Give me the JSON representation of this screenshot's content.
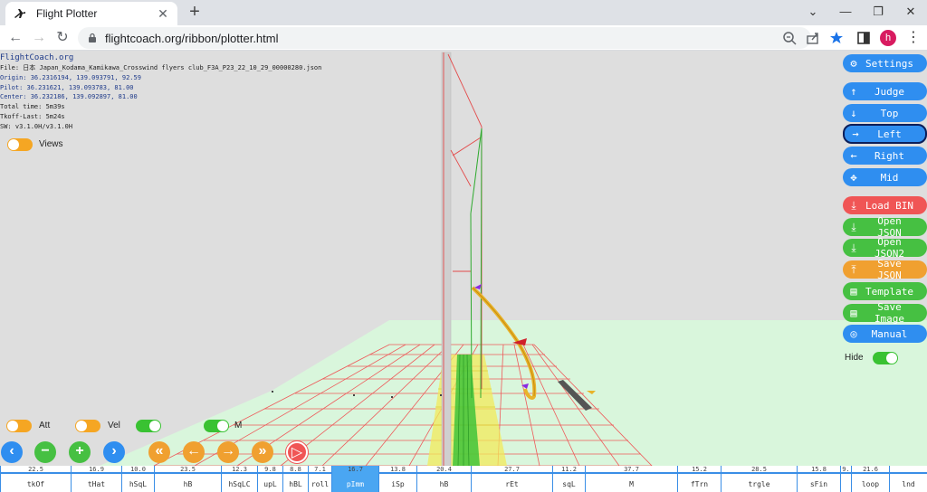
{
  "browser": {
    "tab_title": "Flight Plotter",
    "new_tab": "+",
    "url": "flightcoach.org/ribbon/plotter.html",
    "avatar_letter": "h",
    "minimize": "—",
    "maximize": "❐",
    "close": "✕"
  },
  "info": {
    "site": "FlightCoach.org",
    "file": "File: 日本 Japan_Kodama_Kamikawa_Crosswind flyers club_F3A_P23_22_10_29_00000280.json",
    "origin": "Origin: 36.2316194, 139.093791, 92.59",
    "pilot": "Pilot: 36.231621, 139.093783, 81.00",
    "center": "Center: 36.232186, 139.092897, 81.00",
    "total_time": "Total time: 5m39s",
    "tkoff_last": "Tkoff-Last: 5m24s",
    "sw": "SW: v3.1.0H/v3.1.0H"
  },
  "toggles": {
    "views": "Views",
    "att": "Att",
    "vel": "Vel",
    "m": "M",
    "hide": "Hide"
  },
  "right_buttons": [
    {
      "label": "Settings",
      "icon": "gear-icon",
      "glyph": "⚙"
    },
    {
      "label": "Judge",
      "icon": "arrow-up-icon",
      "glyph": "↑"
    },
    {
      "label": "Top",
      "icon": "arrow-down-icon",
      "glyph": "↓"
    },
    {
      "label": "Left",
      "icon": "arrow-right-icon",
      "glyph": "→"
    },
    {
      "label": "Right",
      "icon": "arrow-left-icon",
      "glyph": "←"
    },
    {
      "label": "Mid",
      "icon": "move-icon",
      "glyph": "✥"
    },
    {
      "label": "Load BIN",
      "icon": "download-icon",
      "glyph": "⤓"
    },
    {
      "label": "Open JSON",
      "icon": "download-icon",
      "glyph": "⤓"
    },
    {
      "label": "Open JSON2",
      "icon": "download-icon",
      "glyph": "⤓"
    },
    {
      "label": "Save JSON",
      "icon": "upload-icon",
      "glyph": "⤒"
    },
    {
      "label": "Template",
      "icon": "document-icon",
      "glyph": "▤"
    },
    {
      "label": "Save Image",
      "icon": "document-icon",
      "glyph": "▤"
    },
    {
      "label": "Manual",
      "icon": "lifebuoy-icon",
      "glyph": "◎"
    }
  ],
  "controls": {
    "prev": "‹",
    "minus": "−",
    "plus": "+",
    "next": "›",
    "rewind": "«",
    "back": "←",
    "forward": "→",
    "fastforward": "»",
    "play": "▷"
  },
  "timeline": [
    {
      "dur": "22.5",
      "name": "tkOf"
    },
    {
      "dur": "16.9",
      "name": "tHat"
    },
    {
      "dur": "10.0",
      "name": "hSqL"
    },
    {
      "dur": "23.5",
      "name": "hB"
    },
    {
      "dur": "12.3",
      "name": "hSqLC"
    },
    {
      "dur": "9.8",
      "name": "upL"
    },
    {
      "dur": "8.8",
      "name": "hBL"
    },
    {
      "dur": "7.1",
      "name": "roll"
    },
    {
      "dur": "16.7",
      "name": "pImm",
      "active": true
    },
    {
      "dur": "13.8",
      "name": "iSp"
    },
    {
      "dur": "20.4",
      "name": "hB"
    },
    {
      "dur": "27.7",
      "name": "rEt"
    },
    {
      "dur": "11.2",
      "name": "sqL"
    },
    {
      "dur": "37.7",
      "name": "M"
    },
    {
      "dur": "15.2",
      "name": "fTrn"
    },
    {
      "dur": "28.5",
      "name": "trgle"
    },
    {
      "dur": "15.8",
      "name": "sFin"
    },
    {
      "dur": "9.",
      "name": ""
    },
    {
      "dur": "21.6",
      "name": "loop"
    },
    {
      "dur": "",
      "name": "lnd"
    }
  ],
  "colors": {
    "accent_blue": "#2f8ef0",
    "red": "#f05555",
    "green": "#46c042",
    "orange": "#f0a030",
    "ground": "#d9f6dc"
  }
}
